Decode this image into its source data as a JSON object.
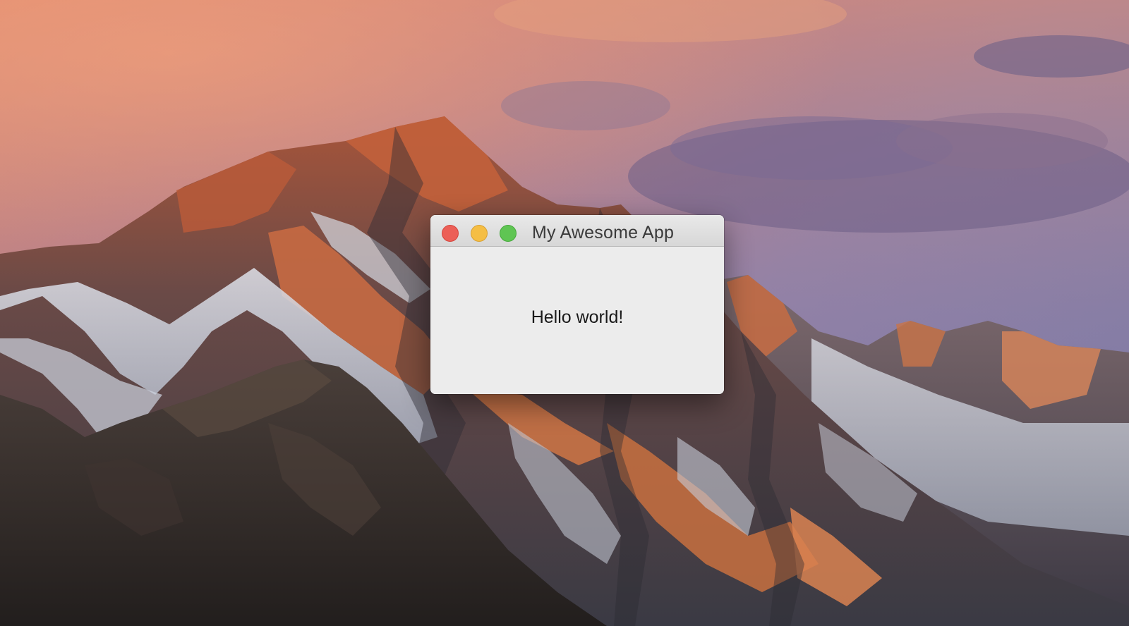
{
  "window": {
    "title": "My Awesome App",
    "body_text": "Hello world!",
    "controls": {
      "close_color": "#ec5f57",
      "minimize_color": "#f5be44",
      "zoom_color": "#5fc553"
    }
  },
  "desktop": {
    "wallpaper": "snowy-mountain-sunset"
  }
}
